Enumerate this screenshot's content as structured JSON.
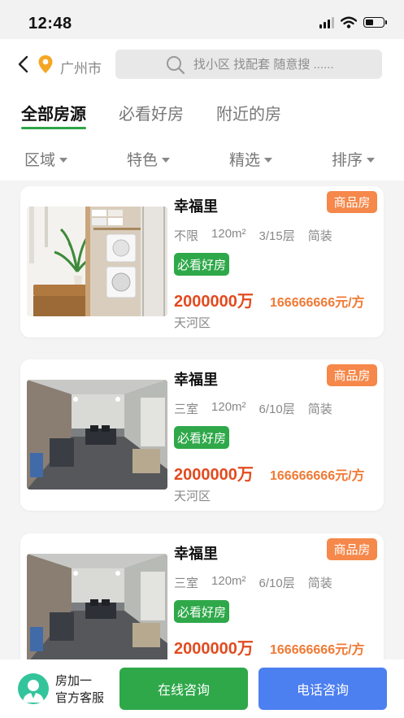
{
  "status_bar": {
    "time": "12:48"
  },
  "header": {
    "city": "广州市",
    "search_placeholder": "找小区 找配套 随意搜 ......"
  },
  "tabs": [
    {
      "label": "全部房源",
      "active": true
    },
    {
      "label": "必看好房",
      "active": false
    },
    {
      "label": "附近的房",
      "active": false
    }
  ],
  "filters": [
    {
      "label": "区域"
    },
    {
      "label": "特色"
    },
    {
      "label": "精选"
    },
    {
      "label": "排序"
    }
  ],
  "listings": [
    {
      "title": "幸福里",
      "type_tag": "商品房",
      "layout": "不限",
      "area": "120m²",
      "floor": "3/15层",
      "decoration": "简装",
      "badge": "必看好房",
      "price": "2000000万",
      "unit_price": "166666666元/方",
      "district": "天河区",
      "photo": "bathroom-laundry-photo"
    },
    {
      "title": "幸福里",
      "type_tag": "商品房",
      "layout": "三室",
      "area": "120m²",
      "floor": "6/10层",
      "decoration": "简装",
      "badge": "必看好房",
      "price": "2000000万",
      "unit_price": "166666666元/方",
      "district": "天河区",
      "photo": "office-room-photo"
    },
    {
      "title": "幸福里",
      "type_tag": "商品房",
      "layout": "三室",
      "area": "120m²",
      "floor": "6/10层",
      "decoration": "简装",
      "badge": "必看好房",
      "price": "2000000万",
      "unit_price": "166666666元/方",
      "district": "",
      "photo": "office-room-photo"
    }
  ],
  "bottom_bar": {
    "service_line1": "房加一",
    "service_line2": "官方客服",
    "online_button": "在线咨询",
    "phone_button": "电话咨询"
  },
  "colors": {
    "accent_green": "#2fa84a",
    "accent_blue": "#4c7ff0",
    "tag_orange": "#f5884a",
    "price_red": "#e24b1f"
  }
}
